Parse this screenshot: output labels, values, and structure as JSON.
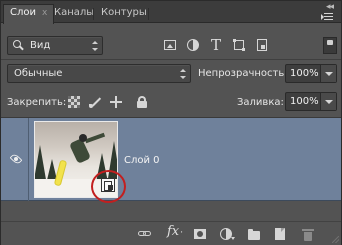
{
  "tabs": [
    {
      "label": "Слои",
      "active": true
    },
    {
      "label": "Каналы",
      "active": false
    },
    {
      "label": "Контуры",
      "active": false
    }
  ],
  "panel_controls": {
    "collapse_glyph": "◂◂",
    "close_glyph": "x",
    "menu_icon": "panel-menu-icon"
  },
  "filter": {
    "kind_label": "Вид",
    "icons": [
      "image-filter-icon",
      "adjustment-filter-icon",
      "type-filter-icon",
      "shape-filter-icon",
      "smart-object-filter-icon"
    ],
    "type_glyph": "T"
  },
  "blending": {
    "mode": "Обычные",
    "opacity_label": "Непрозрачность:",
    "opacity_value": "100%"
  },
  "lock": {
    "label": "Закрепить:",
    "icons": [
      "lock-transparent-pixels-icon",
      "lock-image-pixels-icon",
      "lock-position-icon",
      "lock-all-icon"
    ],
    "fill_label": "Заливка:",
    "fill_value": "100%"
  },
  "layers": [
    {
      "name": "Слой 0",
      "visible": true,
      "selected": true,
      "smart_object": true
    }
  ],
  "bottom_toolbar": {
    "fx_label": "fx",
    "icons": [
      "link-layers-icon",
      "layer-style-icon",
      "add-mask-icon",
      "adjustment-layer-icon",
      "new-group-icon",
      "new-layer-icon",
      "delete-layer-icon"
    ]
  },
  "colors": {
    "panel_bg": "#535353",
    "tabbar_bg": "#3c3c3c",
    "selected_layer": "#6f819b",
    "highlight_ring": "#c21f1f"
  }
}
